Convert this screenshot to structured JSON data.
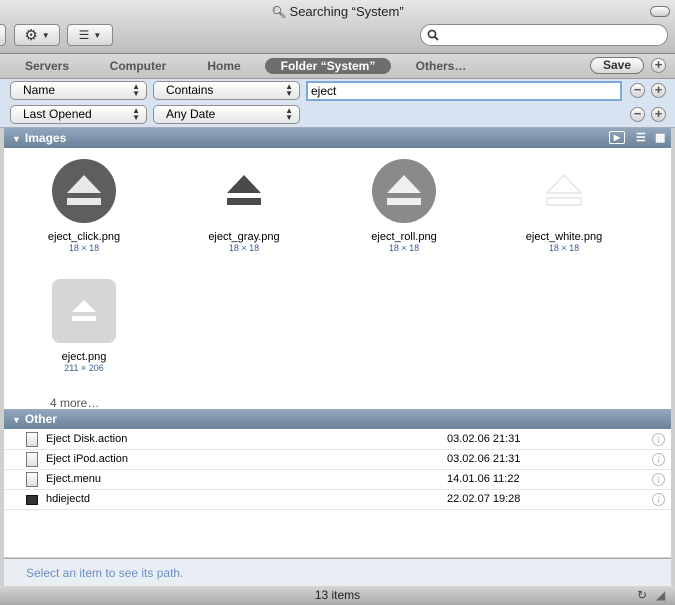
{
  "window": {
    "title": "Searching “System”"
  },
  "toolbar": {
    "search_value": "",
    "search_placeholder": ""
  },
  "scopes": [
    {
      "label": "Servers",
      "selected": false
    },
    {
      "label": "Computer",
      "selected": false
    },
    {
      "label": "Home",
      "selected": false
    },
    {
      "label": "Folder “System”",
      "selected": true
    },
    {
      "label": "Others…",
      "selected": false
    }
  ],
  "save_label": "Save",
  "criteria": [
    {
      "attribute": "Name",
      "operator": "Contains",
      "value": "eject"
    },
    {
      "attribute": "Last Opened",
      "operator": "Any Date"
    }
  ],
  "images_section": {
    "title": "Images",
    "items": [
      {
        "name": "eject_click.png",
        "size": "18 × 18"
      },
      {
        "name": "eject_gray.png",
        "size": "18 × 18"
      },
      {
        "name": "eject_roll.png",
        "size": "18 × 18"
      },
      {
        "name": "eject_white.png",
        "size": "18 × 18"
      },
      {
        "name": "eject.png",
        "size": "211 × 206"
      }
    ],
    "more": "4 more…"
  },
  "other_section": {
    "title": "Other",
    "rows": [
      {
        "name": "Eject Disk.action",
        "date": "03.02.06 21:31"
      },
      {
        "name": "Eject iPod.action",
        "date": "03.02.06 21:31"
      },
      {
        "name": "Eject.menu",
        "date": "14.01.06 11:22"
      },
      {
        "name": "hdiejectd",
        "date": "22.02.07 19:28"
      }
    ]
  },
  "path_hint": "Select an item to see its path.",
  "status": {
    "item_count": "13 items"
  },
  "colors": {
    "section_header": "#7b91a8",
    "criteria_bg": "#d8e3f2",
    "selected_scope": "#6e6e6e"
  }
}
